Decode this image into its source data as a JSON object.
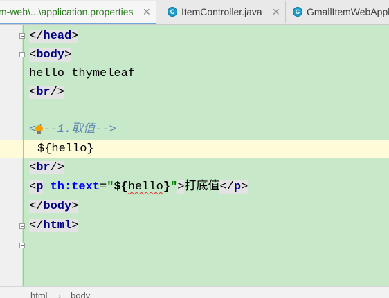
{
  "tabs": [
    {
      "label": "m-web\\...\\application.properties",
      "icon": "properties-file-icon",
      "active": true
    },
    {
      "label": "ItemController.java",
      "icon": "java-class-icon",
      "active": false
    },
    {
      "label": "GmallItemWebApplic",
      "icon": "java-class-icon",
      "active": false
    }
  ],
  "tab_close_glyph": "✕",
  "class_icon_letter": "C",
  "code": {
    "lines": {
      "l0": {
        "open": "</",
        "tag": "head",
        "close": ">"
      },
      "l1": {
        "open": "<",
        "tag": "body",
        "close": ">"
      },
      "l2": {
        "text": "hello thymeleaf"
      },
      "l3": {
        "open": "<",
        "tag": "br",
        "close": "/>"
      },
      "l5": {
        "text": "<!--1.取值-->"
      },
      "l6": {
        "text": "${hello}"
      },
      "l7": {
        "open": "<",
        "tag": "br",
        "close": "/>"
      },
      "l8": {
        "open": "<",
        "tag": "p",
        "attr": "th:text",
        "eq": "=",
        "quote": "\"",
        "expr_open": "${",
        "expr_var": "hello",
        "expr_close": "}",
        "gt": ">",
        "content": "打底值",
        "end_open": "</",
        "end_tag": "p",
        "end_close": ">"
      },
      "l9": {
        "open": "</",
        "tag": "body",
        "close": ">"
      },
      "l10": {
        "open": "</",
        "tag": "html",
        "close": ">"
      }
    }
  },
  "breadcrumb": [
    "html",
    "body"
  ],
  "breadcrumb_sep": "›",
  "colors": {
    "editor_bg": "#c7e9c9",
    "caret_line": "#fefbd8",
    "tag_name": "#000080",
    "attribute": "#0000ff",
    "attribute_value": "#008000",
    "comment": "#5b82b0",
    "active_tab_text": "#2d7a1f"
  }
}
